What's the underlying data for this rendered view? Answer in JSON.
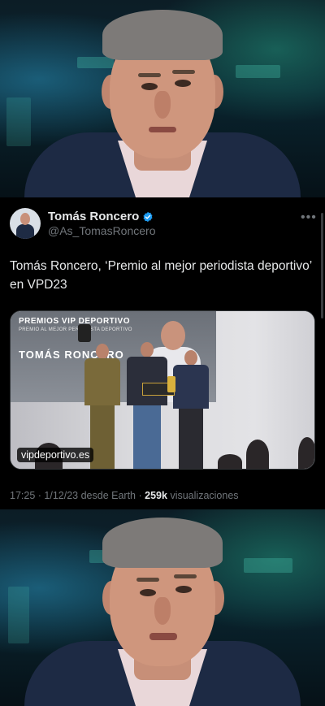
{
  "tweet": {
    "author_name": "Tomás Roncero",
    "author_handle": "@As_TomasRoncero",
    "text": "Tomás Roncero, ‘Premio al mejor periodista deportivo’ en VPD23",
    "media": {
      "source_label": "vipdeportivo.es",
      "banner_line_1": "PREMIOS VIP DEPORTIVO",
      "banner_line_2": "PREMIO AL MEJOR PERIODISTA DEPORTIVO",
      "banner_line_3": "TOMÁS RONCERO"
    },
    "time": "17:25",
    "separator": "·",
    "date": "1/12/23 desde Earth",
    "views_count": "259k",
    "views_label": "visualizaciones"
  },
  "icons": {
    "verified": "verified-badge-icon",
    "more": "more-options-icon"
  },
  "colors": {
    "background": "#000000",
    "text_primary": "#e7e9ea",
    "text_secondary": "#71767b",
    "verified_blue": "#1d9bf0"
  }
}
